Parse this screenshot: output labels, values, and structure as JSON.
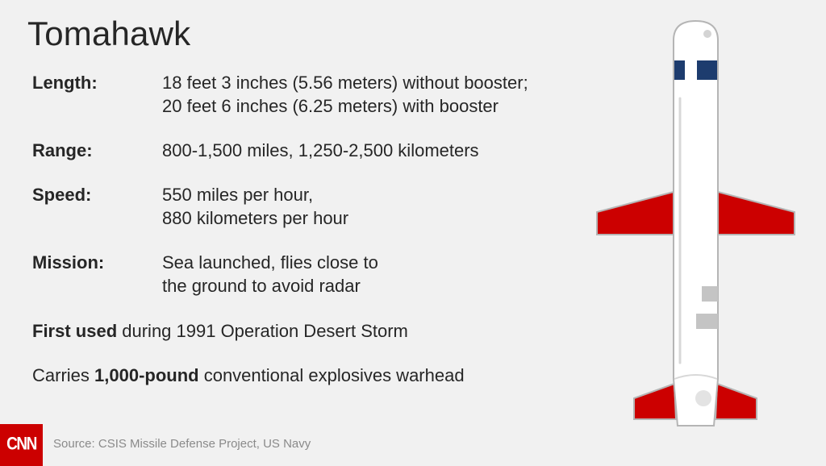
{
  "title": "Tomahawk",
  "facts": [
    {
      "label": "Length:",
      "lines": [
        "18 feet 3 inches (5.56 meters) without booster;",
        "20 feet 6 inches (6.25 meters) with booster"
      ]
    },
    {
      "label": "Range:",
      "lines": [
        "800-1,500 miles, 1,250-2,500 kilometers"
      ]
    },
    {
      "label": "Speed:",
      "lines": [
        "550 miles per hour,",
        "880 kilometers per hour"
      ]
    },
    {
      "label": "Mission:",
      "lines": [
        "Sea launched, flies close to",
        "the ground to avoid radar"
      ]
    }
  ],
  "first_used": {
    "bold": "First used",
    "rest": " during 1991 Operation Desert Storm"
  },
  "carries": {
    "pre": "Carries ",
    "bold": "1,000-pound",
    "post": " conventional explosives warhead"
  },
  "logo_text": "CNN",
  "source": "Source: CSIS Missile Defense Project, US Navy",
  "colors": {
    "wing_red": "#cc0000",
    "band_blue": "#1d3c6e",
    "body": "#ffffff",
    "outline": "#b5b5b5",
    "vent": "#c4c4c4"
  }
}
